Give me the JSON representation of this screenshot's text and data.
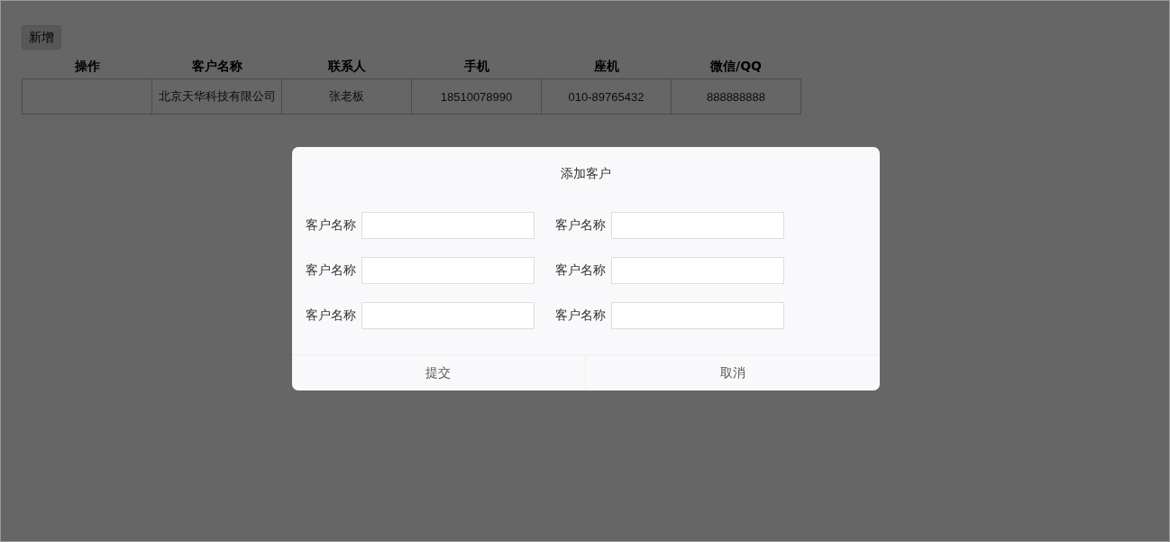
{
  "toolbar": {
    "add_button": "新增"
  },
  "table": {
    "columns": [
      "操作",
      "客户名称",
      "联系人",
      "手机",
      "座机",
      "微信/QQ"
    ],
    "rows": [
      [
        "",
        "北京天华科技有限公司",
        "张老板",
        "18510078990",
        "010-89765432",
        "888888888"
      ]
    ]
  },
  "dialog": {
    "title": "添加客户",
    "fields": [
      {
        "label": "客户名称"
      },
      {
        "label": "客户名称"
      },
      {
        "label": "客户名称"
      },
      {
        "label": "客户名称"
      },
      {
        "label": "客户名称"
      },
      {
        "label": "客户名称"
      }
    ],
    "buttons": [
      "提交",
      "取消"
    ]
  }
}
